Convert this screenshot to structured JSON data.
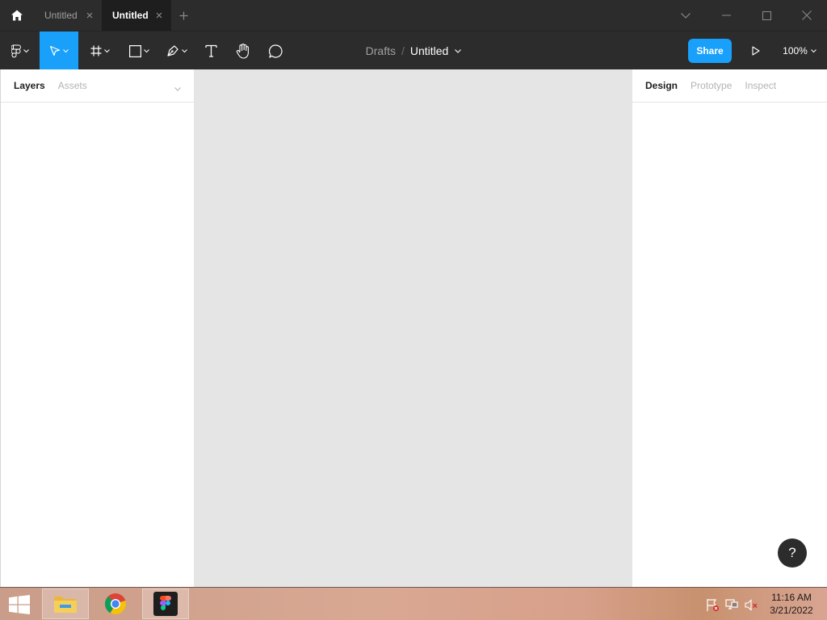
{
  "titlebar": {
    "tabs": [
      {
        "label": "Untitled",
        "active": false
      },
      {
        "label": "Untitled",
        "active": true
      }
    ]
  },
  "toolbar": {
    "tools": [
      "figma-menu-icon",
      "move-icon",
      "frame-icon",
      "rectangle-icon",
      "pen-icon",
      "text-icon",
      "hand-icon",
      "comment-icon"
    ],
    "active_tool": "move-icon",
    "breadcrumb": {
      "location": "Drafts",
      "separator": "/",
      "file_name": "Untitled"
    },
    "share_label": "Share",
    "zoom": "100%"
  },
  "left_panel": {
    "tabs": [
      {
        "label": "Layers",
        "active": true
      },
      {
        "label": "Assets",
        "active": false
      }
    ]
  },
  "right_panel": {
    "tabs": [
      {
        "label": "Design",
        "active": true
      },
      {
        "label": "Prototype",
        "active": false
      },
      {
        "label": "Inspect",
        "active": false
      }
    ]
  },
  "help_label": "?",
  "taskbar": {
    "apps": [
      "file-explorer-icon",
      "chrome-icon",
      "figma-icon"
    ],
    "tray": [
      "flag-icon",
      "network-icon",
      "volume-muted-icon"
    ],
    "time": "11:16 AM",
    "date": "3/21/2022"
  },
  "colors": {
    "accent": "#18a0fb",
    "chrome_dark": "#2c2c2c",
    "canvas": "#e5e5e5"
  }
}
